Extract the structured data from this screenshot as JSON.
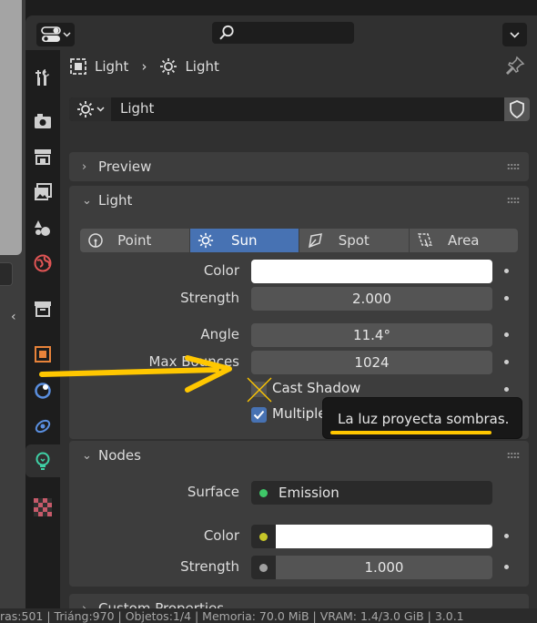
{
  "colors": {
    "accent": "#4772b3",
    "annotation": "#ffc700",
    "panel_bg": "#3d3d3d",
    "editor_bg": "#303030"
  },
  "header": {
    "editor_type_icon": "editor-type-icon",
    "search_placeholder": ""
  },
  "breadcrumb": {
    "object_name": "Light",
    "data_name": "Light"
  },
  "datablock": {
    "name": "Light"
  },
  "panels": {
    "preview": "Preview",
    "light": "Light",
    "nodes": "Nodes",
    "custom_properties": "Custom Properties"
  },
  "light_types": [
    {
      "label": "Point",
      "icon": "point-light-icon",
      "active": false
    },
    {
      "label": "Sun",
      "icon": "sun-light-icon",
      "active": true
    },
    {
      "label": "Spot",
      "icon": "spot-light-icon",
      "active": false
    },
    {
      "label": "Area",
      "icon": "area-light-icon",
      "active": false
    }
  ],
  "light_props": {
    "color_label": "Color",
    "color_value": "#ffffff",
    "strength_label": "Strength",
    "strength_value": "2.000",
    "angle_label": "Angle",
    "angle_value": "11.4°",
    "max_bounces_label": "Max Bounces",
    "max_bounces_value": "1024",
    "cast_shadow_label": "Cast Shadow",
    "cast_shadow_checked": false,
    "multiple_importance_label": "Multiple Importance",
    "multiple_importance_checked": true
  },
  "tooltip": {
    "text": "La luz  proyecta sombras."
  },
  "nodes": {
    "surface_label": "Surface",
    "surface_value": "Emission",
    "color_label": "Color",
    "color_value": "#ffffff",
    "strength_label": "Strength",
    "strength_value": "1.000"
  },
  "statusbar": {
    "text": "ras:501 | Triáng:970 | Objetos:1/4 | Memoria: 70.0 MiB | VRAM: 1.4/3.0 GiB | 3.0.1"
  }
}
